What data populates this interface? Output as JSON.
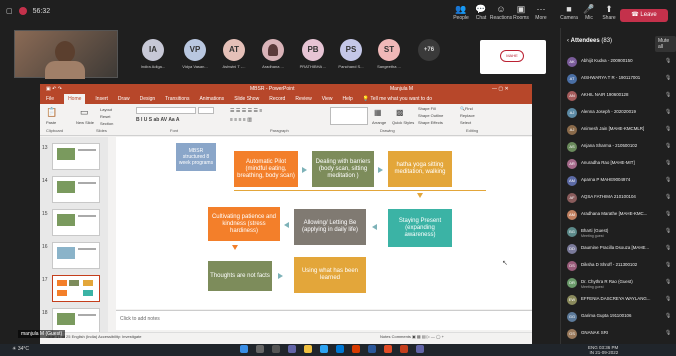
{
  "meeting": {
    "timer": "56:32",
    "toolbar": [
      {
        "label": "People",
        "icon": "people-icon"
      },
      {
        "label": "Chat",
        "icon": "chat-icon"
      },
      {
        "label": "Reactions",
        "icon": "reactions-icon"
      },
      {
        "label": "Rooms",
        "icon": "rooms-icon"
      },
      {
        "label": "More",
        "icon": "more-icon"
      },
      {
        "label": "Camera",
        "icon": "camera-icon"
      },
      {
        "label": "Mic",
        "icon": "mic-icon"
      },
      {
        "label": "Share",
        "icon": "share-icon"
      }
    ],
    "leave_label": "Leave",
    "participants": [
      {
        "initials": "IA",
        "name": "Indira Adiga...",
        "color": "#c7c8d6"
      },
      {
        "initials": "VP",
        "name": "Vidya Vasan...",
        "color": "#b9c7e0"
      },
      {
        "initials": "AT",
        "name": "Ashwini T -...",
        "color": "#e5c0b8"
      },
      {
        "initials": "",
        "name": "Aradhana ...",
        "color": "#e5c6c9"
      },
      {
        "initials": "PB",
        "name": "PRATHIBHA ...",
        "color": "#e6c4d4"
      },
      {
        "initials": "PS",
        "name": "Panchand S...",
        "color": "#c4c7e8"
      },
      {
        "initials": "ST",
        "name": "Sangeetha ...",
        "color": "#f0b8b8"
      }
    ],
    "overflow_count": "+76",
    "logo_tile_text": "MAHE",
    "presenter_tag": "manjula M (Guest)"
  },
  "ppt": {
    "window_title": "MBSR - PowerPoint",
    "user": "Manjula M",
    "tabs": [
      "File",
      "Home",
      "Insert",
      "Draw",
      "Design",
      "Transitions",
      "Animations",
      "Slide Show",
      "Record",
      "Review",
      "View",
      "Help"
    ],
    "active_tab": "Home",
    "tell_me": "Tell me what you want to do",
    "ribbon_groups": [
      "Clipboard",
      "Slides",
      "Font",
      "Paragraph",
      "Drawing",
      "Editing"
    ],
    "ribbon_items": {
      "paste": "Paste",
      "new_slide": "New Slide",
      "layout": "Layout",
      "reset": "Reset",
      "section": "Section",
      "arrange": "Arrange",
      "quick_styles": "Quick Styles",
      "shape_fill": "Shape Fill",
      "shape_outline": "Shape Outline",
      "shape_effects": "Shape Effects",
      "find": "Find",
      "replace": "Replace",
      "select": "Select"
    },
    "thumb_numbers": [
      "13",
      "14",
      "15",
      "16",
      "17",
      "18"
    ],
    "selected_thumb": "17",
    "notes_placeholder": "Click to add notes",
    "status_left": "Slide 17 of 25",
    "status_lang": "English (India)",
    "status_access": "Accessibility: Investigate",
    "status_notes": "Notes",
    "status_comments": "Comments"
  },
  "slide": {
    "mbsr_box": "MBSR structured 8 week programs",
    "auto_pilot": "Automatic Pilot (mindful eating, breathing, body scan)",
    "barriers": "Dealing with barriers (body scan, sitting meditation )",
    "hatha": "hatha yoga sitting meditation, walking",
    "patience": "Cultivating patience and kindness (stress hardiness)",
    "allowing": "Allowing/ Letting Be (applying in daily life)",
    "staying": "Staying Present (expanding awareness)",
    "thoughts": "Thoughts are not facts",
    "using": "Using what has been learned"
  },
  "attendees": {
    "title": "Attendees",
    "count": "(83)",
    "mute_all": "Mute all",
    "list": [
      {
        "initials": "AK",
        "name": "Abhijit Kudva - 200900150",
        "color": "#7a5c9a"
      },
      {
        "initials": "AT",
        "name": "AISHWARYA T R - 190117001",
        "color": "#4a6fa5"
      },
      {
        "initials": "AN",
        "name": "AKHIL NAIR 190600128",
        "color": "#a55c5c"
      },
      {
        "initials": "AJ",
        "name": "Alenna Joseph - 202020019",
        "color": "#5c8aa5"
      },
      {
        "initials": "AJ",
        "name": "Animesh Jain [MAHE-KMCMLR]",
        "color": "#8a6a4a"
      },
      {
        "initials": "AS",
        "name": "Anjana Sharma - 210500102",
        "color": "#6a8a5c"
      },
      {
        "initials": "AR",
        "name": "Anuradha Rao [MAHE-MIT]",
        "color": "#a56a8a"
      },
      {
        "initials": "AM",
        "name": "Aparna P MAHE9004974",
        "color": "#5c6aa5"
      },
      {
        "initials": "AF",
        "name": "AQSA FATHIMA 210100104",
        "color": "#8a5c5c"
      },
      {
        "initials": "AM",
        "name": "Aradhana Marathe [MAHE-KMC...",
        "color": "#c08060"
      },
      {
        "initials": "BG",
        "name": "Bharti (Guest)",
        "sub": "Meeting guest",
        "color": "#5c8a8a"
      },
      {
        "initials": "DD",
        "name": "Daumine Pracilla Dsouza [MAHE...",
        "color": "#7a7a9a"
      },
      {
        "initials": "DS",
        "name": "Diksha D Shroff - 211300102",
        "color": "#9a5c7a"
      },
      {
        "initials": "DR",
        "name": "Dr. Chythra R Rao (Guest)",
        "sub": "Meeting guest",
        "color": "#6a9a6a"
      },
      {
        "initials": "EW",
        "name": "EFFENIA DASCREYA WAYLANG...",
        "color": "#8a8a5c"
      },
      {
        "initials": "GG",
        "name": "Garima Gupta 191100106",
        "color": "#5c7a9a"
      },
      {
        "initials": "GS",
        "name": "GNANAK SRI",
        "color": "#9a7a5c"
      }
    ]
  },
  "taskbar": {
    "weather": "34°C",
    "lang": "ENG",
    "region": "IN",
    "time": "03:36 PM",
    "date": "21-09-2022"
  }
}
